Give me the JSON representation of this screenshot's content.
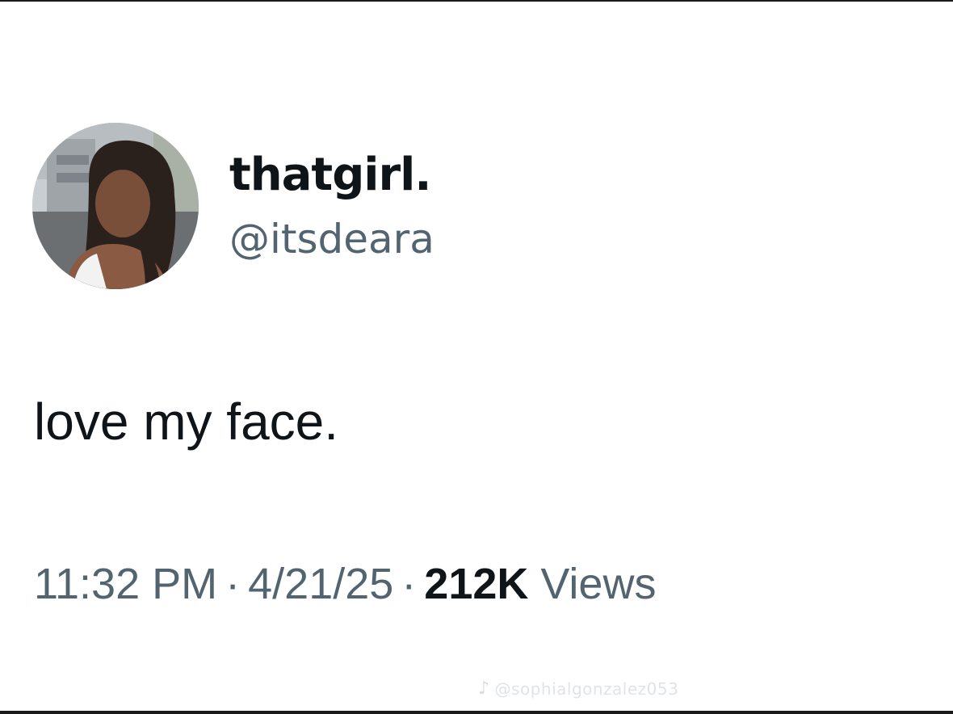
{
  "tweet": {
    "display_name": "thatgirl.",
    "handle": "@itsdeara",
    "text": "love my face.",
    "time": "11:32 PM",
    "date": "4/21/25",
    "views_count": "212K",
    "views_label": "Views",
    "separator": "·"
  },
  "watermark": {
    "platform_icon": "tiktok-icon",
    "text": "@sophialgonzalez053"
  },
  "colors": {
    "primary_text": "#0f1419",
    "secondary_text": "#536471",
    "background": "#ffffff"
  }
}
